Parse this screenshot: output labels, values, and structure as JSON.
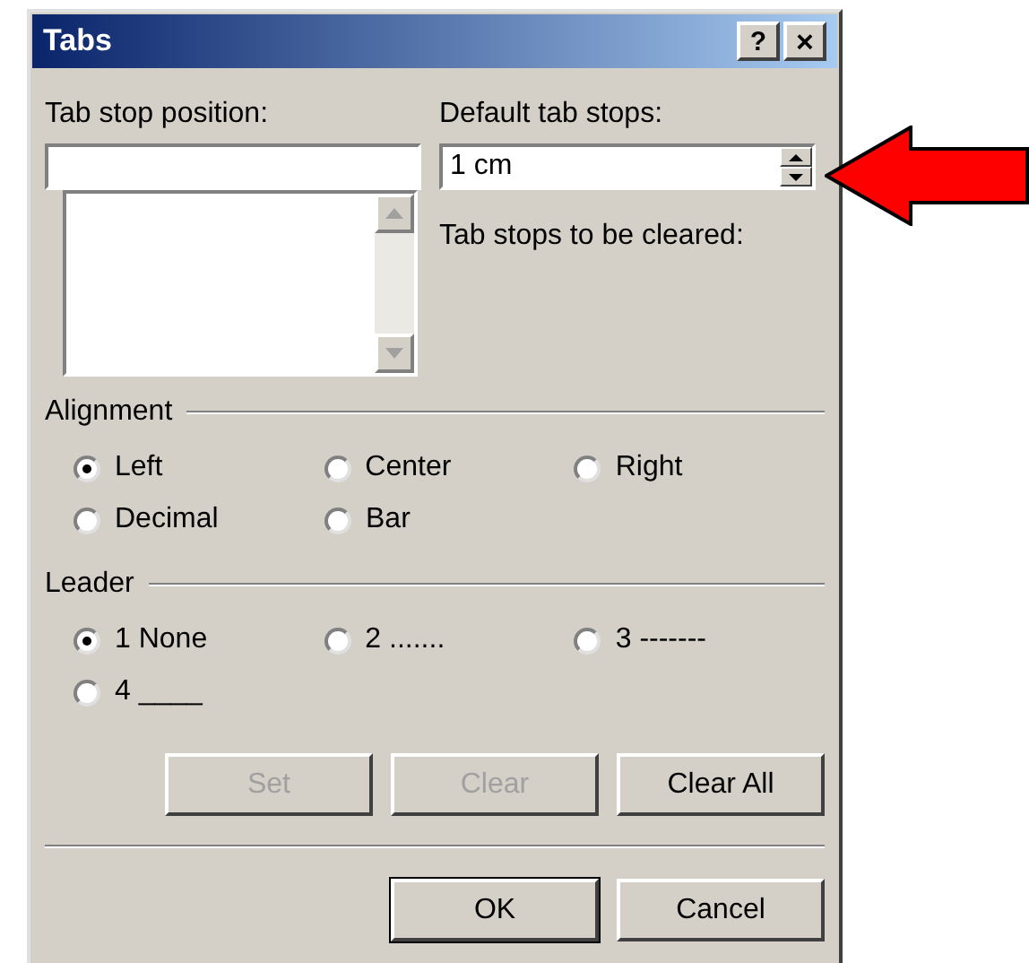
{
  "window": {
    "title": "Tabs",
    "help_button": "?",
    "close_button": "×"
  },
  "tab_stop_position": {
    "label": "Tab stop position:"
  },
  "default_tab_stops": {
    "label": "Default tab stops:",
    "value": "1 cm"
  },
  "tab_stops_to_be_cleared": "Tab stops to be cleared:",
  "alignment": {
    "title": "Alignment",
    "options": [
      {
        "label": "Left",
        "selected": true
      },
      {
        "label": "Center",
        "selected": false
      },
      {
        "label": "Right",
        "selected": false
      },
      {
        "label": "Decimal",
        "selected": false
      },
      {
        "label": "Bar",
        "selected": false
      }
    ]
  },
  "leader": {
    "title": "Leader",
    "options": [
      {
        "label": "1 None",
        "selected": true
      },
      {
        "label": "2 .......",
        "selected": false
      },
      {
        "label": "3 -------",
        "selected": false
      },
      {
        "label": "4 ____",
        "selected": false
      }
    ]
  },
  "tab_buttons": [
    {
      "label": "Set",
      "disabled": true
    },
    {
      "label": "Clear",
      "disabled": true
    },
    {
      "label": "Clear All",
      "disabled": false
    }
  ],
  "dialog_buttons": [
    {
      "label": "OK",
      "default": true
    },
    {
      "label": "Cancel",
      "default": false
    }
  ]
}
